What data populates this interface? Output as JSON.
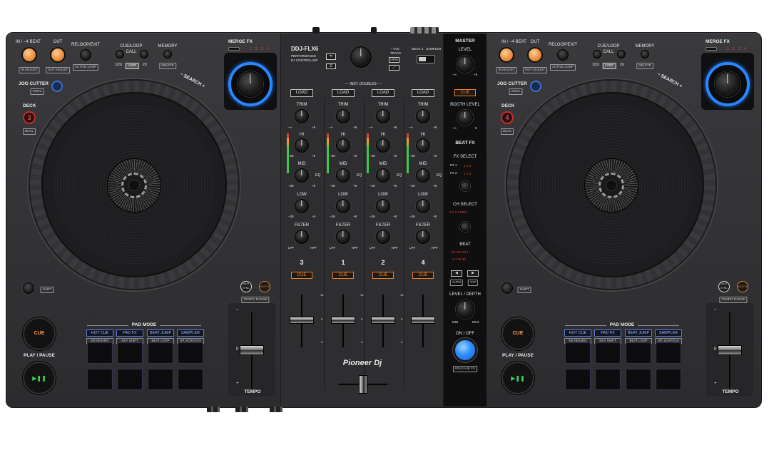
{
  "device": {
    "model": "DDJ-FLX6",
    "subtitle_line1": "PERFORMANCE",
    "subtitle_line2": "DJ CONTROLLER",
    "brand": "Pioneer Dj"
  },
  "deck": {
    "in_beat": "IN / −4 BEAT",
    "out": "OUT",
    "reloop_exit": "RELOOP/EXIT",
    "in_adjust": "IN ADJUST",
    "out_adjust": "OUT ADJUST",
    "active_loop": "ACTIVE LOOP",
    "cue_loop_call_1": "CUE/LOOP",
    "cue_loop_call_2": "CALL",
    "memory": "MEMORY",
    "half": "1/2X",
    "loop": "LOOP",
    "double": "2X",
    "delete": "DELETE",
    "jog_cutter": "JOG CUTTER",
    "vinyl": "VINYL",
    "deck_label": "DECK",
    "dual": "DUAL",
    "search": "− SEARCH +",
    "shift": "SHIFT",
    "cue": "CUE",
    "play_pause": "PLAY / PAUSE",
    "pad_mode": "PAD MODE",
    "beat_sync": "BEAT SYNC",
    "master_btn": "MASTER",
    "tempo_range": "TEMPO RANGE",
    "tempo": "TEMPO",
    "merge_fx": "MERGE FX",
    "fx_nums": [
      "1",
      "2",
      "3",
      "4"
    ],
    "pad_modes": [
      {
        "main": "HOT CUE",
        "sub": "KEYBOARD"
      },
      {
        "main": "PAD FX",
        "sub": "KEY SHIFT"
      },
      {
        "main": "BEAT JUMP",
        "sub": "BEAT LOOP"
      },
      {
        "main": "SAMPLER",
        "sub": "SP. SCRATCH"
      }
    ],
    "tempo_scale": [
      "−",
      "0",
      "+"
    ]
  },
  "left_deck": {
    "deck_number": "3"
  },
  "right_deck": {
    "deck_number": "4"
  },
  "browse": {
    "tag_track_1": "− TAG",
    "tag_track_2": "TRACK",
    "view": "VIEW",
    "deck_switch_left": "DECK 4",
    "deck_switch_right": "SAMPLER"
  },
  "mixer": {
    "inst_doubles": "−− INST. DOUBLES −−",
    "load": "LOAD",
    "trim": "TRIM",
    "hi": "HI",
    "mid": "MID",
    "low": "LOW",
    "filter": "FILTER",
    "eq": "EQ",
    "lpf": "LPF",
    "hpf": "HPF",
    "min_db": "−∞",
    "trim_max": "+9",
    "eq_min": "−26",
    "eq_max": "+6",
    "cue": "CUE",
    "channels": [
      "3",
      "1",
      "2",
      "4"
    ],
    "fader_scale": [
      "10",
      "9",
      "8",
      "7",
      "6",
      "5",
      "4",
      "3",
      "2",
      "1",
      "0"
    ]
  },
  "master": {
    "master": "MASTER",
    "level": "LEVEL",
    "min": "−∞",
    "max": "+6",
    "cue": "CUE",
    "booth_level": "BOOTH LEVEL",
    "booth_max": "0",
    "beat_fx": "BEAT FX",
    "fx_select": "FX SELECT",
    "fx1": "FX 1",
    "fx2": "FX 2",
    "fx_numbers": "1  2  3",
    "ch_select": "CH SELECT",
    "ch_select_values": "3  1  2  4  MST",
    "beat": "BEAT",
    "beat_row1": "1/4  1/2  3/4  1",
    "beat_row2": "2  4  16  32",
    "auto": "AUTO",
    "tap": "TAP",
    "arrow_left": "◀",
    "arrow_right": "▶",
    "level_depth": "LEVEL / DEPTH",
    "depth_min": "MIN",
    "depth_max": "MAX",
    "on_off": "ON / OFF",
    "release_fx": "RELEASE FX"
  },
  "colors": {
    "body": "#303033",
    "jog_ring": "#3a3a3d",
    "accent_orange": "#f39a4a",
    "fx_blue": "#1e90ff",
    "pad_blue": "#5c7dd6"
  }
}
